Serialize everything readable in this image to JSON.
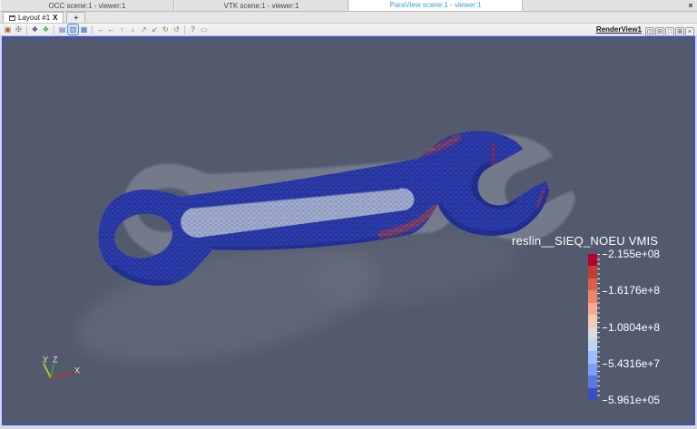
{
  "window": {
    "close_label": "×"
  },
  "scene_tabs": [
    {
      "label": "OCC scene:1 - viewer:1",
      "active": false
    },
    {
      "label": "VTK scene:1 - viewer:1",
      "active": false
    },
    {
      "label": "ParaView scene:1 - viewer:1",
      "active": true
    }
  ],
  "layout_tabs": {
    "active_label": "Layout #1",
    "close_label": "X",
    "add_label": "+"
  },
  "toolbar": {
    "view_title": "RenderView1",
    "icons": [
      {
        "name": "dump-view-icon",
        "glyph": "▣",
        "color": "#a85c40"
      },
      {
        "name": "interaction-style-icon",
        "glyph": "✠",
        "color": "#70809a"
      },
      {
        "sep": true
      },
      {
        "name": "view-3d-icon",
        "glyph": "❖",
        "color": "#303a55"
      },
      {
        "name": "fit-all-icon",
        "glyph": "❖",
        "color": "#3f9e4d"
      },
      {
        "sep": true
      },
      {
        "name": "projection-x-icon",
        "glyph": "▤",
        "color": "#4a6ab8"
      },
      {
        "name": "projection-y-icon",
        "glyph": "▥",
        "color": "#4a6ab8",
        "selected": true
      },
      {
        "name": "projection-z-icon",
        "glyph": "▦",
        "color": "#4a6ab8"
      },
      {
        "sep": true
      },
      {
        "name": "view-plus-x-icon",
        "glyph": "→",
        "color": "#3f9e4d"
      },
      {
        "name": "view-minus-x-icon",
        "glyph": "←",
        "color": "#b84a3f"
      },
      {
        "name": "view-plus-y-icon",
        "glyph": "↑",
        "color": "#3f9e4d"
      },
      {
        "name": "view-minus-y-icon",
        "glyph": "↓",
        "color": "#b84a3f"
      },
      {
        "name": "view-plus-z-icon",
        "glyph": "↗",
        "color": "#3f9e4d"
      },
      {
        "name": "view-minus-z-icon",
        "glyph": "↙",
        "color": "#b84a3f"
      },
      {
        "name": "rotate-right-icon",
        "glyph": "↻",
        "color": "#8a7a3a"
      },
      {
        "name": "rotate-left-icon",
        "glyph": "↺",
        "color": "#8a7a3a"
      },
      {
        "sep": true
      },
      {
        "name": "help-icon",
        "glyph": "?",
        "color": "#3a6ab8"
      },
      {
        "name": "scaling-icon",
        "glyph": "▭",
        "color": "#8a8a8a"
      }
    ],
    "window_buttons": [
      {
        "name": "split-horizontal-button",
        "glyph": "◫"
      },
      {
        "name": "split-vertical-button",
        "glyph": "⊟"
      },
      {
        "name": "maximize-view-button",
        "glyph": "□"
      },
      {
        "name": "detach-view-button",
        "glyph": "⊞"
      },
      {
        "name": "close-view-button",
        "glyph": "×"
      }
    ]
  },
  "render_view": {
    "background_color": "#535a6e",
    "legend": {
      "title": "reslin__SIEQ_NOEU VMIS",
      "labels": [
        "2.155e+08",
        "1.6176e+8",
        "1.0804e+8",
        "5.4316e+7",
        "5.961e+05"
      ],
      "colors": [
        "#b40426",
        "#c43c35",
        "#dd5f4b",
        "#ee8468",
        "#f7ac8e",
        "#f2cab5",
        "#dddcdc",
        "#c0d4f5",
        "#9ebeff",
        "#7b9ff9",
        "#5977e3",
        "#3b4cc0"
      ]
    },
    "axes": {
      "x": {
        "label": "X",
        "color": "#c03024"
      },
      "y": {
        "label": "Y",
        "color": "#cfcf2a"
      },
      "z": {
        "label": "Z",
        "color": "#2fae2f"
      }
    },
    "model": {
      "description": "wrench finite-element mesh, von Mises stress",
      "mesh_color": "#2e3eb0",
      "stress_color": "#cc4a33",
      "ghost_color": "#c0c3cb"
    }
  }
}
